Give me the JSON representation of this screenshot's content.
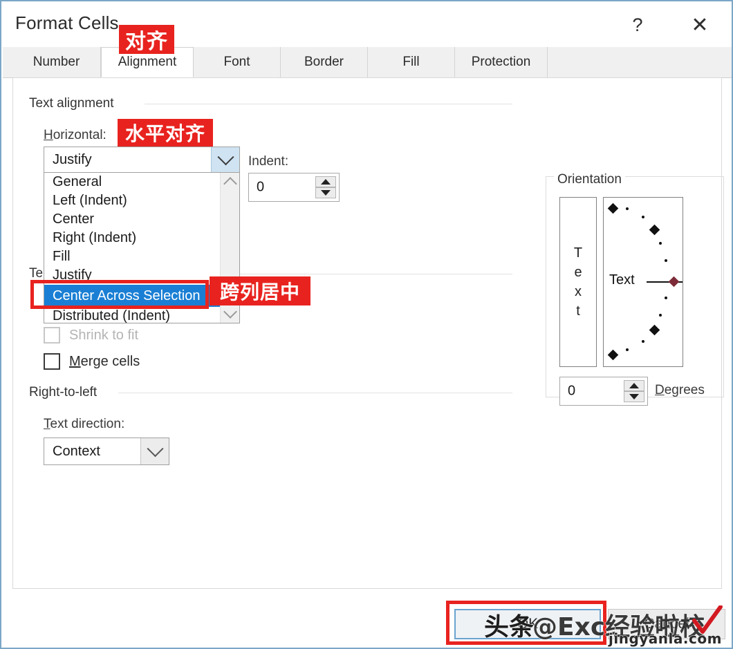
{
  "window": {
    "title": "Format Cells",
    "help_label": "?",
    "close_label": "✕"
  },
  "tabs": [
    {
      "label": "Number",
      "active": false
    },
    {
      "label": "Alignment",
      "active": true
    },
    {
      "label": "Font",
      "active": false
    },
    {
      "label": "Border",
      "active": false
    },
    {
      "label": "Fill",
      "active": false
    },
    {
      "label": "Protection",
      "active": false
    }
  ],
  "text_alignment": {
    "group_label": "Text alignment",
    "horizontal_label": "Horizontal:",
    "horizontal_value": "Justify",
    "indent_label": "Indent:",
    "indent_value": "0",
    "dropdown_options": [
      "General",
      "Left (Indent)",
      "Center",
      "Right (Indent)",
      "Fill",
      "Justify",
      "Center Across Selection",
      "Distributed (Indent)"
    ],
    "dropdown_selected": "Center Across Selection"
  },
  "text_control": {
    "group_label": "Te",
    "shrink_label": "Shrink to fit",
    "shrink_checked": false,
    "shrink_disabled": true,
    "merge_label": "Merge cells",
    "merge_checked": false
  },
  "right_to_left": {
    "group_label": "Right-to-left",
    "direction_label": "Text direction:",
    "direction_value": "Context"
  },
  "orientation": {
    "group_label": "Orientation",
    "vertical_text": "Text",
    "vertical_chars": [
      "T",
      "e",
      "x",
      "t"
    ],
    "dial_text": "Text",
    "degrees_value": "0",
    "degrees_label": "Degrees"
  },
  "footer": {
    "ok_label": "OK",
    "cancel_label": "Cancel"
  },
  "annotations": [
    {
      "id": "align-anno",
      "text": "对齐"
    },
    {
      "id": "horiz-anno",
      "text": "水平对齐"
    },
    {
      "id": "center-anno",
      "text": "跨列居中"
    }
  ],
  "watermark": {
    "toutiao": "头条",
    "main": "@Exc经验啦校",
    "sub": "jingyanla.com"
  },
  "colors": {
    "annotation_red": "#e8231f",
    "selection_blue": "#1a7fd4",
    "focus_blue": "#6aa3cf",
    "dial_marker_red": "#7d2b38"
  }
}
